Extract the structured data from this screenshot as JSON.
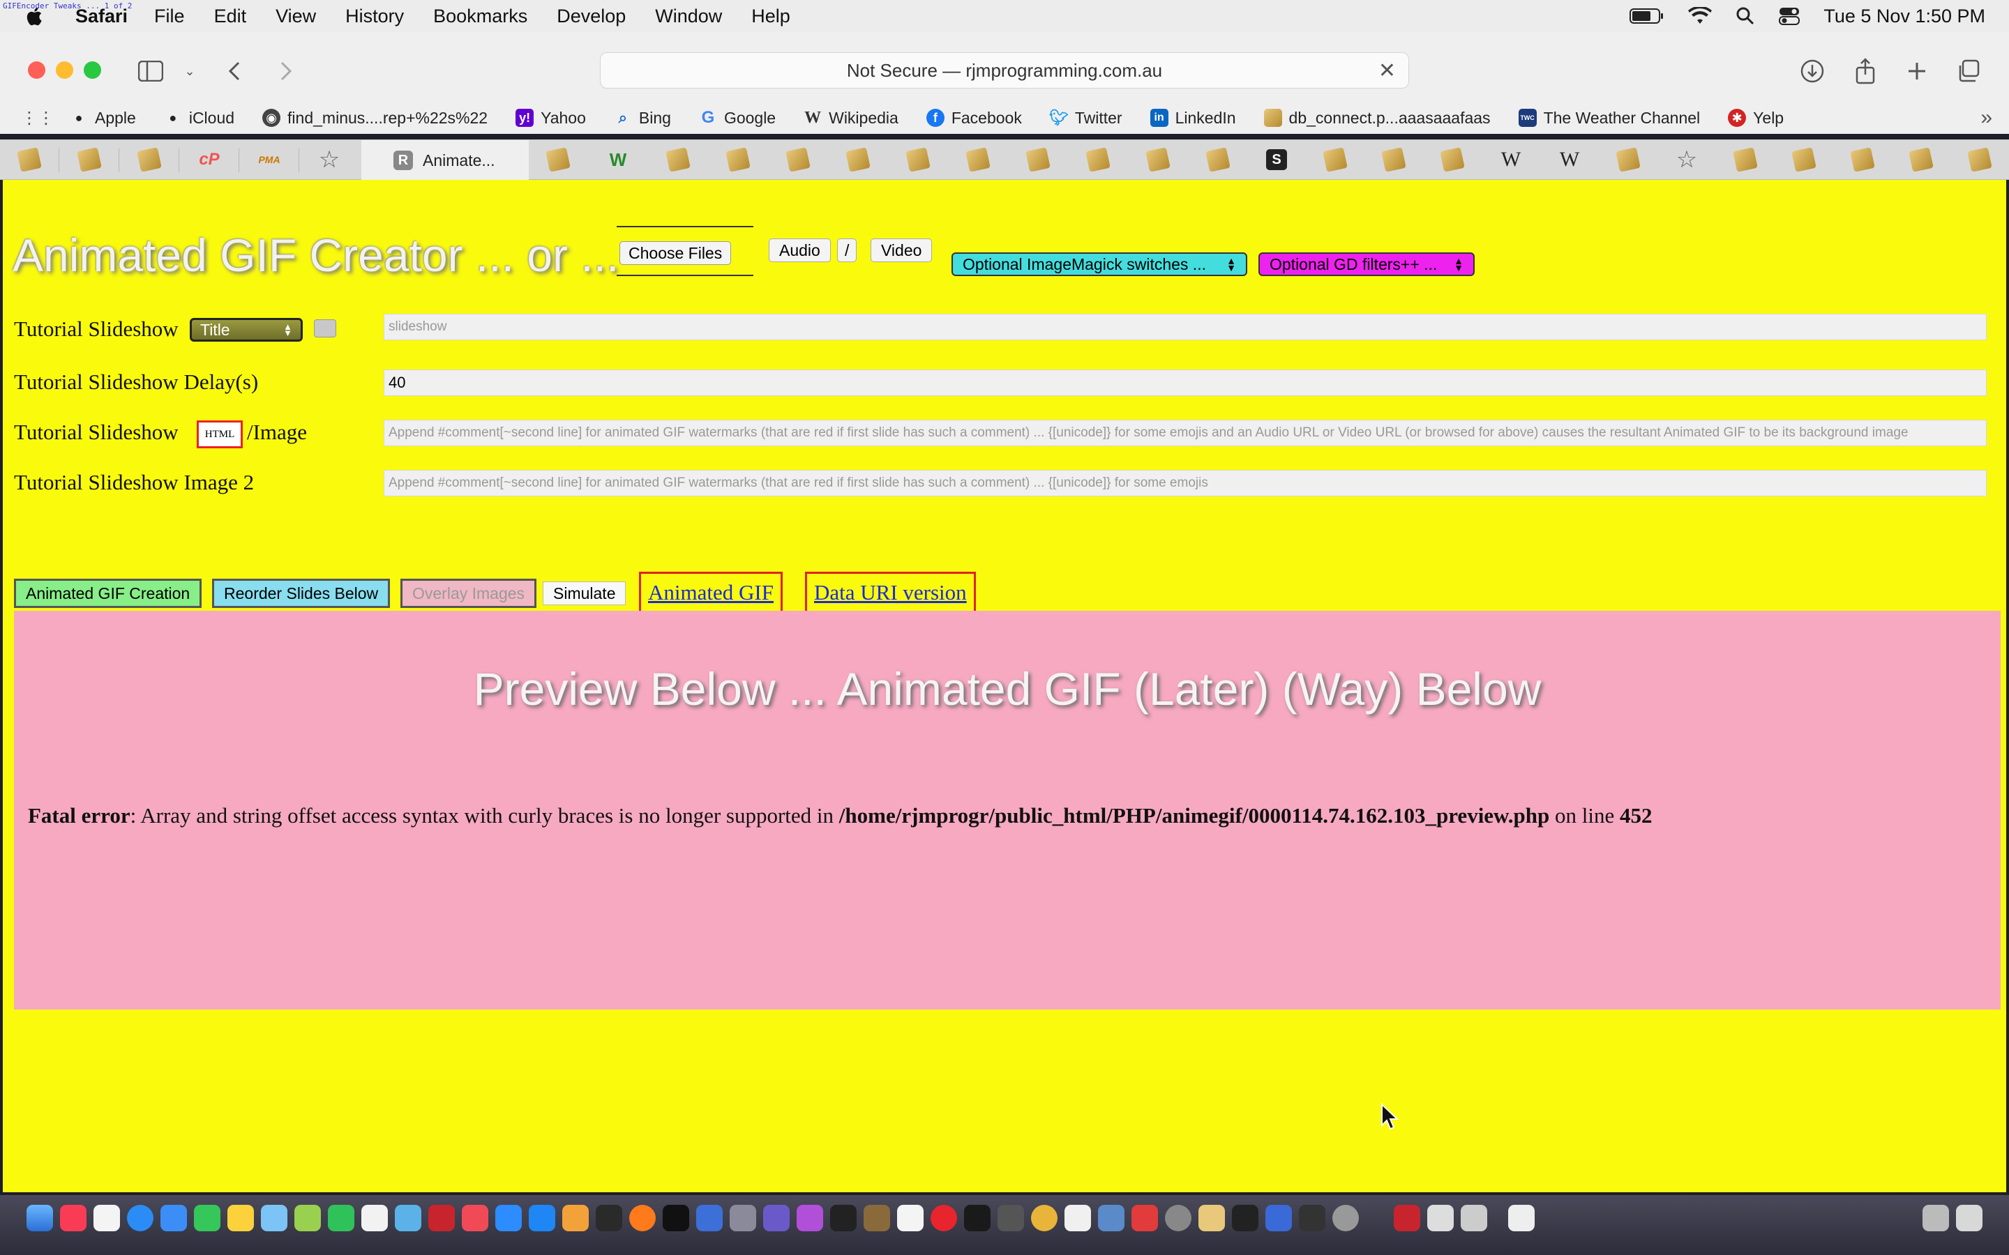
{
  "menubar": {
    "app": "Safari",
    "items": [
      "File",
      "Edit",
      "View",
      "History",
      "Bookmarks",
      "Develop",
      "Window",
      "Help"
    ],
    "clock": "Tue 5 Nov  1:50 PM",
    "overlay_text": "GIFEncoder Tweaks ... 1 of 2"
  },
  "toolbar": {
    "address": "Not Secure — rjmprogramming.com.au"
  },
  "favorites": [
    {
      "label": "Apple",
      "icon": "apple-icon",
      "color": "#222222"
    },
    {
      "label": "iCloud",
      "icon": "apple-icon",
      "color": "#222222"
    },
    {
      "label": "find_minus....rep+%22s%22",
      "icon": "github-icon",
      "color": "#444444"
    },
    {
      "label": "Yahoo",
      "icon": "yahoo-icon",
      "color": "#6001d2"
    },
    {
      "label": "Bing",
      "icon": "search-icon",
      "color": "#1f6fd6"
    },
    {
      "label": "Google",
      "icon": "google-icon",
      "color": "#4285f4"
    },
    {
      "label": "Wikipedia",
      "icon": "wikipedia-icon",
      "color": "#333333"
    },
    {
      "label": "Facebook",
      "icon": "facebook-icon",
      "color": "#1877f2"
    },
    {
      "label": "Twitter",
      "icon": "twitter-icon",
      "color": "#1d9bf0"
    },
    {
      "label": "LinkedIn",
      "icon": "linkedin-icon",
      "color": "#0a66c2"
    },
    {
      "label": "db_connect.p...aaasaaafaas",
      "icon": "feather-icon",
      "color": "#b48a2e"
    },
    {
      "label": "The Weather Channel",
      "icon": "weather-icon",
      "color": "#1b3b7a"
    },
    {
      "label": "Yelp",
      "icon": "yelp-icon",
      "color": "#d32323"
    }
  ],
  "active_tab": {
    "label": "Animate...",
    "letter": "R"
  },
  "page": {
    "title": "Animated GIF Creator ... or ...",
    "choose_files": "Choose Files",
    "audio": "Audio",
    "slash": "/",
    "video": "Video",
    "imagemagick_select": "Optional ImageMagick switches ...",
    "gd_select": "Optional GD filters++ ...",
    "rows": [
      {
        "label": "Tutorial Slideshow",
        "value": "",
        "placeholder": "slideshow"
      },
      {
        "label": "Tutorial Slideshow Delay(s)",
        "value": "40",
        "placeholder": ""
      },
      {
        "label": "Tutorial Slideshow",
        "label_suffix": "/Image",
        "value": "",
        "placeholder": "Append #comment[~second line] for animated GIF watermarks (that are red if first slide has such a comment) ... {[unicode]} for some emojis and an Audio URL or Video URL (or browsed for above) causes the resultant Animated GIF to be its background image"
      },
      {
        "label": "Tutorial Slideshow Image 2",
        "value": "",
        "placeholder": "Append #comment[~second line] for animated GIF watermarks (that are red if first slide has such a comment) ... {[unicode]} for some emojis"
      }
    ],
    "title_select": "Title",
    "html_badge": "HTML",
    "buttons": {
      "creation": "Animated GIF Creation",
      "reorder": "Reorder Slides Below",
      "overlay": "Overlay Images",
      "simulate": "Simulate"
    },
    "links": {
      "animated_gif": "Animated GIF",
      "data_uri": "Data URI version"
    },
    "preview": {
      "heading": "Preview Below ... Animated GIF (Later) (Way) Below",
      "error_label": "Fatal error",
      "error_text": ": Array and string offset access syntax with curly braces is no longer supported in ",
      "error_path": "/home/rjmprogr/public_html/PHP/animegif/0000114.74.162.103_preview.php",
      "error_online": " on line ",
      "error_line": "452"
    }
  },
  "colors": {
    "page_bg": "#fafa0c",
    "preview_bg": "#f7a9c2",
    "creation_btn": "#88ee88",
    "reorder_btn": "#88ddee",
    "imagemagick_select": "#44dddd",
    "gd_select": "#ee22ee",
    "link_color": "#1a2ad8"
  }
}
